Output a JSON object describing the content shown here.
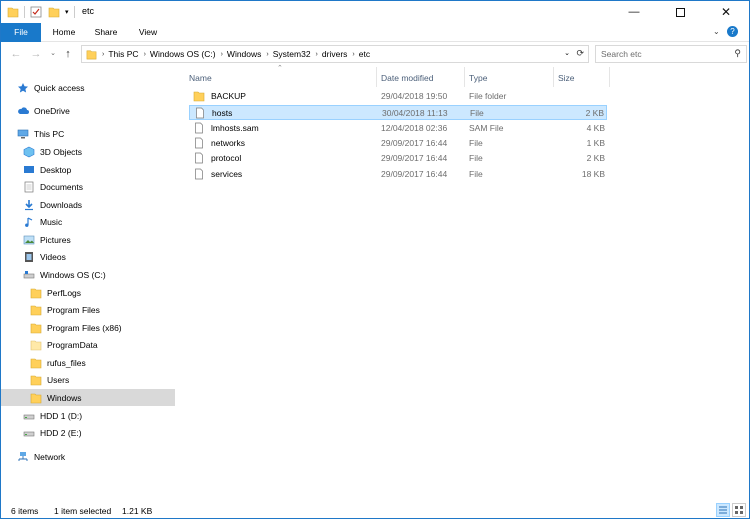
{
  "window": {
    "title": "etc"
  },
  "ribbon": {
    "tabs": [
      "File",
      "Home",
      "Share",
      "View"
    ]
  },
  "address": {
    "crumbs": [
      "This PC",
      "Windows OS (C:)",
      "Windows",
      "System32",
      "drivers",
      "etc"
    ],
    "search_placeholder": "Search etc"
  },
  "sidebar": {
    "items": [
      {
        "label": "Quick access",
        "icon": "star-icon"
      },
      {
        "label": "OneDrive",
        "icon": "cloud-icon"
      },
      {
        "label": "This PC",
        "icon": "computer-icon"
      },
      {
        "label": "3D Objects",
        "icon": "cube-icon"
      },
      {
        "label": "Desktop",
        "icon": "desktop-icon"
      },
      {
        "label": "Documents",
        "icon": "documents-icon"
      },
      {
        "label": "Downloads",
        "icon": "download-icon"
      },
      {
        "label": "Music",
        "icon": "music-icon"
      },
      {
        "label": "Pictures",
        "icon": "pictures-icon"
      },
      {
        "label": "Videos",
        "icon": "video-icon"
      },
      {
        "label": "Windows OS (C:)",
        "icon": "drive-icon"
      },
      {
        "label": "PerfLogs",
        "icon": "folder-icon"
      },
      {
        "label": "Program Files",
        "icon": "folder-icon"
      },
      {
        "label": "Program Files (x86)",
        "icon": "folder-icon"
      },
      {
        "label": "ProgramData",
        "icon": "folder-icon"
      },
      {
        "label": "rufus_files",
        "icon": "folder-icon"
      },
      {
        "label": "Users",
        "icon": "folder-icon"
      },
      {
        "label": "Windows",
        "icon": "folder-icon"
      },
      {
        "label": "HDD 1 (D:)",
        "icon": "drive-icon"
      },
      {
        "label": "HDD 2 (E:)",
        "icon": "drive-icon"
      },
      {
        "label": "Network",
        "icon": "network-icon"
      }
    ],
    "selected": "Windows"
  },
  "columns": [
    "Name",
    "Date modified",
    "Type",
    "Size"
  ],
  "files": [
    {
      "name": "BACKUP",
      "date": "29/04/2018 19:50",
      "type": "File folder",
      "size": "",
      "icon": "folder-icon"
    },
    {
      "name": "hosts",
      "date": "30/04/2018 11:13",
      "type": "File",
      "size": "2 KB",
      "icon": "file-icon",
      "selected": true
    },
    {
      "name": "lmhosts.sam",
      "date": "12/04/2018 02:36",
      "type": "SAM File",
      "size": "4 KB",
      "icon": "file-icon"
    },
    {
      "name": "networks",
      "date": "29/09/2017 16:44",
      "type": "File",
      "size": "1 KB",
      "icon": "file-icon"
    },
    {
      "name": "protocol",
      "date": "29/09/2017 16:44",
      "type": "File",
      "size": "2 KB",
      "icon": "file-icon"
    },
    {
      "name": "services",
      "date": "29/09/2017 16:44",
      "type": "File",
      "size": "18 KB",
      "icon": "file-icon"
    }
  ],
  "status": {
    "count": "6 items",
    "selection": "1 item selected",
    "size": "1.21 KB"
  },
  "colors": {
    "accent": "#1979ca",
    "selected_bg": "#cce8ff",
    "folder": "#ffd05a"
  }
}
